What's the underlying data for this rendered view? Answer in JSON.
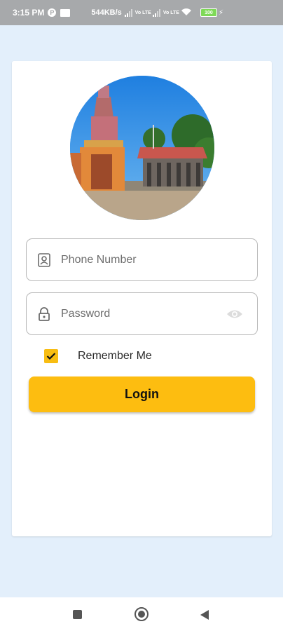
{
  "status_bar": {
    "time": "3:15 PM",
    "network_speed": "544KB/s",
    "volte_1": "Vo LTE",
    "volte_2": "Vo LTE",
    "battery": "100"
  },
  "login_form": {
    "phone_field": {
      "placeholder": "Phone Number",
      "value": ""
    },
    "password_field": {
      "placeholder": "Password",
      "value": ""
    },
    "remember_me": {
      "label": "Remember Me",
      "checked": true
    },
    "login_button": {
      "label": "Login"
    }
  },
  "icons": {
    "phone": "contact-card-icon",
    "password": "lock-icon",
    "visibility": "eye-icon",
    "check": "check-icon"
  },
  "colors": {
    "accent": "#fdbd10",
    "background": "#e3effb",
    "card": "#ffffff",
    "status_bar": "#a7a9ab"
  }
}
